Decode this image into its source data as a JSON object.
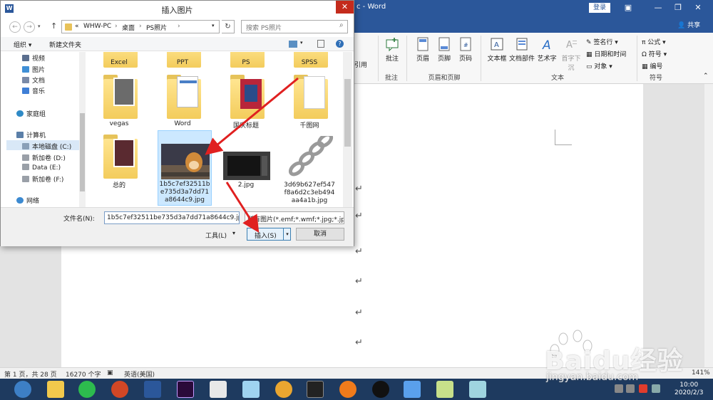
{
  "word": {
    "title": "c - Word",
    "login": "登录",
    "share": "共享",
    "ribbon": {
      "citation": "引用",
      "comment": "批注",
      "comment_group": "批注",
      "header": "页眉",
      "footer": "页脚",
      "page_number": "页码",
      "header_footer_group": "页眉和页脚",
      "textbox": "文本框",
      "quick_parts": "文档部件",
      "wordart": "艺术字",
      "dropcap": "首字下沉",
      "signature": "签名行",
      "datetime": "日期和时间",
      "object": "对象",
      "text_group": "文本",
      "equation": "公式",
      "symbol": "符号",
      "numbering": "编号",
      "symbol_group": "符号"
    },
    "status": {
      "page": "第 1 页，共 28 页",
      "words": "16270 个字",
      "language": "英语(美国)",
      "zoom": "141%"
    },
    "paragraph_mark": "↵"
  },
  "dialog": {
    "title": "插入图片",
    "close": "✕",
    "breadcrumb": [
      "«",
      "WHW-PC",
      "桌面",
      "PS照片"
    ],
    "search_placeholder": "搜索 PS照片",
    "toolbar": {
      "organize": "组织 ▾",
      "new_folder": "新建文件夹"
    },
    "nav_tree": [
      {
        "label": "视频",
        "color": "#5b6f8f"
      },
      {
        "label": "图片",
        "color": "#3f8fd6"
      },
      {
        "label": "文档",
        "color": "#7a8aa8"
      },
      {
        "label": "音乐",
        "color": "#3f7fd6"
      },
      {
        "label": "家庭组",
        "color": "#2f8ac6"
      },
      {
        "label": "计算机",
        "color": "#5b7fa8"
      },
      {
        "label": "本地磁盘 (C:)",
        "color": "#8aa0b8"
      },
      {
        "label": "新加卷 (D:)",
        "color": "#9aa0a8"
      },
      {
        "label": "Data (E:)",
        "color": "#9aa0a8"
      },
      {
        "label": "新加卷 (F:)",
        "color": "#9aa0a8"
      },
      {
        "label": "网络",
        "color": "#3c8ad1"
      }
    ],
    "files": [
      {
        "name": "Excel"
      },
      {
        "name": "PPT"
      },
      {
        "name": "PS"
      },
      {
        "name": "SPSS"
      },
      {
        "name": "vegas"
      },
      {
        "name": "Word"
      },
      {
        "name": "国庆标题"
      },
      {
        "name": "千图网"
      },
      {
        "name": "总的"
      },
      {
        "name": "1b5c7ef32511be735d3a7dd71a8644c9.jpg",
        "lines": [
          "1b5c7ef32511b",
          "e735d3a7dd71",
          "a8644c9.jpg"
        ]
      },
      {
        "name": "2.jpg"
      },
      {
        "name": "3d69b627ef547f8a6d2c3eb494aa4a1b.jpg",
        "lines": [
          "3d69b627ef547",
          "f8a6d2c3eb494",
          "aa4a1b.jpg"
        ]
      }
    ],
    "filename_label": "文件名(N):",
    "filename_value": "1b5c7ef32511be735d3a7dd71a8644c9.jpg",
    "filetype_value": "所有图片(*.emf;*.wmf;*.jpg;*.jp",
    "tools": "工具(L)",
    "insert": "插入(S)",
    "cancel": "取消"
  },
  "taskbar": {
    "time": "10:00",
    "date": "2020/2/3"
  },
  "watermark": {
    "brand": "Baidu经验",
    "site": "jingyan.baidu.com"
  }
}
